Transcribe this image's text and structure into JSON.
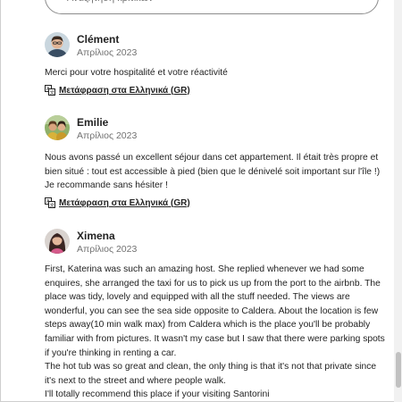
{
  "search": {
    "placeholder": "Αναζήτηση κριτικών",
    "icon": "search-icon"
  },
  "reviews": [
    {
      "name": "Clément",
      "date": "Απρίλιος 2023",
      "paragraphs": [
        "Merci pour votre hospitalité et votre réactivité"
      ],
      "translate_label": "Μετάφραση στα Ελληνικά (GR)"
    },
    {
      "name": "Emilie",
      "date": "Απρίλιος 2023",
      "paragraphs": [
        "Nous avons passé un excellent séjour dans cet appartement. Il était très propre et bien situé : tout est accessible à pied (bien que le dénivelé soit important sur l'île !)",
        "Je recommande sans hésiter !"
      ],
      "translate_label": "Μετάφραση στα Ελληνικά (GR)"
    },
    {
      "name": "Ximena",
      "date": "Απρίλιος 2023",
      "paragraphs": [
        "First, Katerina was such an amazing host. She replied whenever we had some enquires, she arranged the taxi for us to pick us up from the port to the airbnb. The place was tidy, lovely and equipped with all the stuff needed. The views are wonderful, you can see the sea side opposite to Caldera. About the location is few steps away(10 min walk max) from Caldera which is the place you'll be probably familiar with from pictures. It wasn't my case but I saw that there were parking spots if you're thinking in renting a car.",
        "The hot tub was so great and clean, the only thing is that it's not that private since it's next to the street and where people walk.",
        "I'll totally recommend this place if your visiting Santorini"
      ]
    }
  ]
}
